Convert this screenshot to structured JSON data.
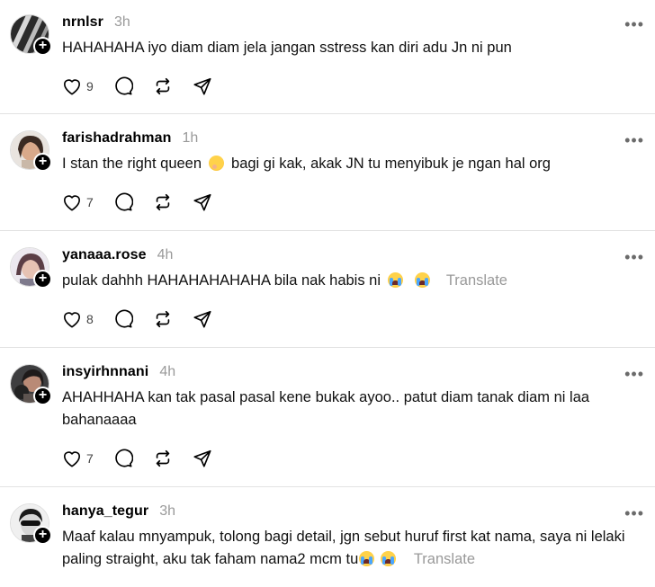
{
  "posts": [
    {
      "username": "nrnlsr",
      "time": "3h",
      "text": "HAHAHAHA iyo diam diam jela jangan sstress kan diri adu Jn ni pun",
      "text2": "",
      "likes": "9",
      "translate": ""
    },
    {
      "username": "farishadrahman",
      "time": "1h",
      "text": "I stan the right queen",
      "text_after": "bagi gi kak, akak JN tu menyibuk je ngan hal org",
      "likes": "7",
      "translate": ""
    },
    {
      "username": "yanaaa.rose",
      "time": "4h",
      "text": "pulak dahhh HAHAHAHAHAHA bila nak habis ni",
      "likes": "8",
      "translate": "Translate"
    },
    {
      "username": "insyirhnnani",
      "time": "4h",
      "text": "AHAHHAHA kan tak pasal pasal kene bukak ayoo.. patut diam tanak diam ni laa bahanaaaa",
      "likes": "7",
      "translate": ""
    },
    {
      "username": "hanya_tegur",
      "time": "3h",
      "text": "Maaf kalau mnyampuk, tolong bagi detail, jgn sebut huruf first kat nama, saya ni lelaki paling straight, aku tak faham nama2 mcm tu",
      "likes": "",
      "translate": "Translate"
    }
  ],
  "icons": {
    "like": "heart-icon",
    "reply": "comment-icon",
    "repost": "repost-icon",
    "share": "send-icon",
    "more": "more-icon",
    "follow": "plus-icon"
  },
  "ui": {
    "more_glyph": "•••",
    "follow_glyph": "+"
  }
}
